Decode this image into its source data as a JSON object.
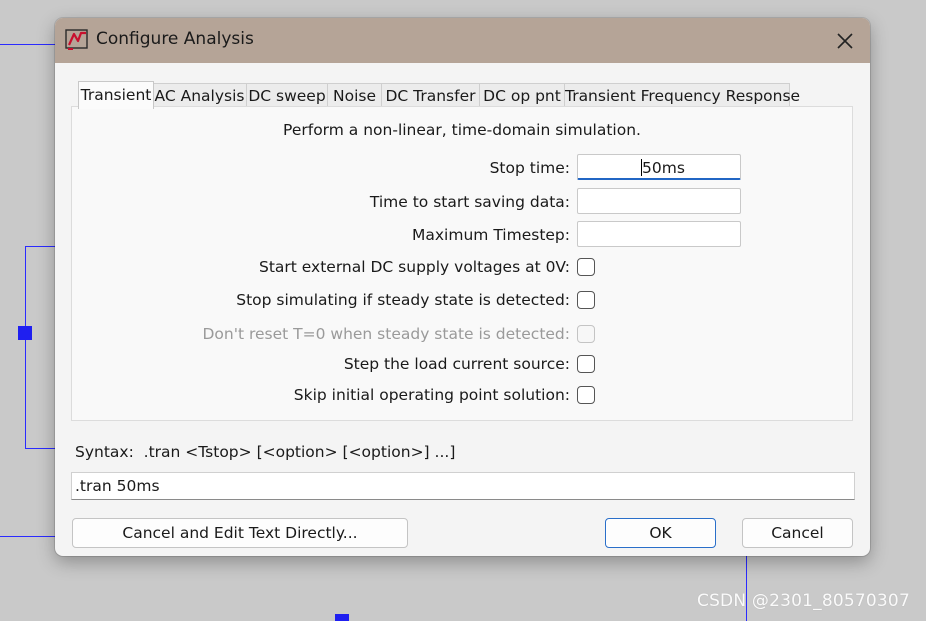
{
  "dialog": {
    "title": "Configure Analysis",
    "app_icon": "ltspice-logo-icon",
    "close_icon": "close-icon"
  },
  "tabs": [
    {
      "label": "Transient",
      "active": true
    },
    {
      "label": "AC Analysis",
      "active": false
    },
    {
      "label": "DC sweep",
      "active": false
    },
    {
      "label": "Noise",
      "active": false
    },
    {
      "label": "DC Transfer",
      "active": false
    },
    {
      "label": "DC op pnt",
      "active": false
    },
    {
      "label": "Transient Frequency Response",
      "active": false
    }
  ],
  "transient": {
    "description": "Perform a non-linear, time-domain simulation.",
    "stop_time": {
      "label": "Stop time:",
      "value": "50ms"
    },
    "start_saving": {
      "label": "Time to start saving data:",
      "value": ""
    },
    "max_timestep": {
      "label": "Maximum Timestep:",
      "value": ""
    },
    "options": [
      {
        "label": "Start external DC supply voltages at 0V:",
        "checked": false,
        "enabled": true
      },
      {
        "label": "Stop simulating if steady state is detected:",
        "checked": false,
        "enabled": true
      },
      {
        "label": "Don't reset T=0 when steady state is detected:",
        "checked": false,
        "enabled": false
      },
      {
        "label": "Step the load current source:",
        "checked": false,
        "enabled": true
      },
      {
        "label": "Skip initial operating point solution:",
        "checked": false,
        "enabled": true
      }
    ]
  },
  "syntax": {
    "label": "Syntax:  .tran <Tstop> [<option> [<option>] ...]",
    "command": ".tran 50ms"
  },
  "buttons": {
    "edit_directly": "Cancel and Edit Text Directly...",
    "ok": "OK",
    "cancel": "Cancel"
  },
  "watermark": "CSDN @2301_80570307",
  "colors": {
    "titlebar": "#b5a497",
    "schematic_wire": "#2b2bff",
    "focus_accent": "#2166c4"
  }
}
